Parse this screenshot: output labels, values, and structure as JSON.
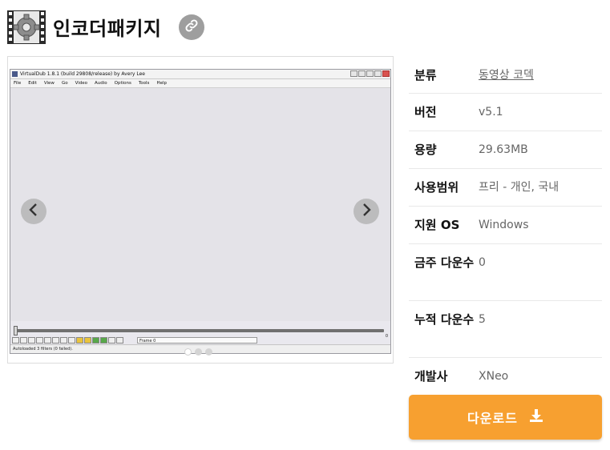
{
  "header": {
    "title": "인코더패키지",
    "app_icon": "film-gear-icon",
    "link_icon": "link-icon"
  },
  "screenshot": {
    "window_title": "VirtualDub 1.8.1 (build 29808/release) by Avery Lee",
    "menu": [
      "File",
      "Edit",
      "View",
      "Go",
      "Video",
      "Audio",
      "Options",
      "Tools",
      "Help"
    ],
    "frame_label": "Frame 0",
    "end_frame": "0",
    "status": "Autoloaded 3 filters (0 failed)."
  },
  "carousel": {
    "prev_icon": "chevron-left-icon",
    "next_icon": "chevron-right-icon",
    "slides": 3,
    "active_slide": 1
  },
  "info": [
    {
      "key": "분류",
      "value": "동영상 코덱",
      "is_link": true
    },
    {
      "key": "버전",
      "value": "v5.1"
    },
    {
      "key": "용량",
      "value": "29.63MB"
    },
    {
      "key": "사용범위",
      "value": "프리 - 개인, 국내"
    },
    {
      "key": "지원 OS",
      "value": "Windows"
    },
    {
      "key": "금주 다운수",
      "value": "0"
    },
    {
      "key": "누적 다운수",
      "value": "5"
    },
    {
      "key": "개발사",
      "value": "XNeo"
    }
  ],
  "download": {
    "label": "다운로드",
    "icon": "download-icon",
    "color": "#f7a030"
  }
}
